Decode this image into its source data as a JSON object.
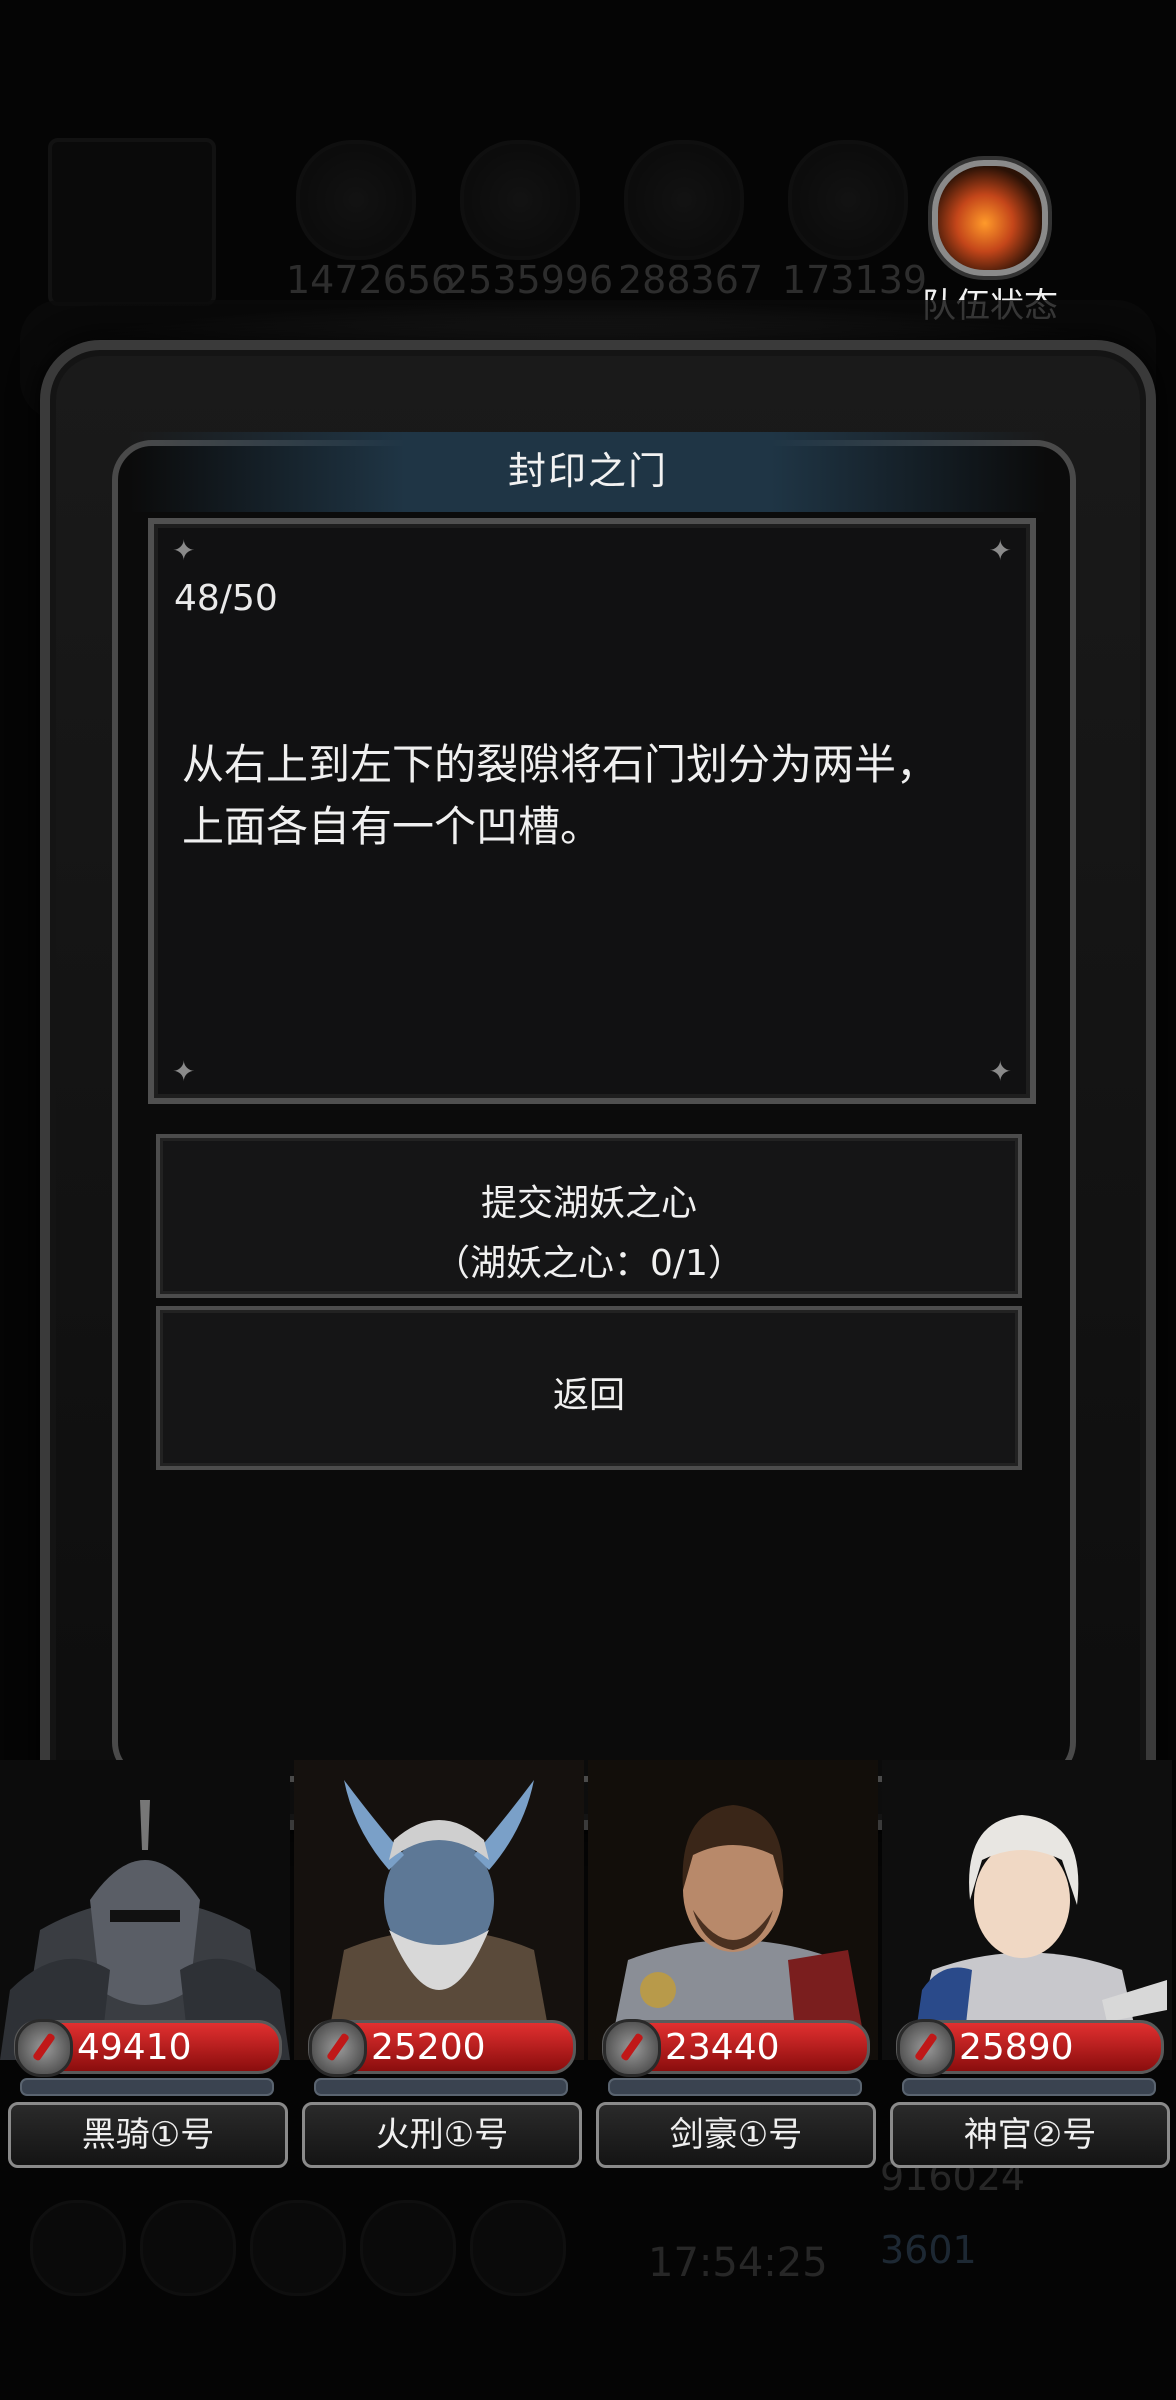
{
  "background_hud": {
    "resources": [
      "1472656",
      "2535996",
      "288367",
      "173139"
    ],
    "clock": "17:54:25",
    "gold": "916024",
    "gems": "3601"
  },
  "team_status": {
    "label": "队伍状态",
    "icon": "fire-emblem-icon"
  },
  "dialog": {
    "title": "封印之门",
    "counter": "48/50",
    "description_line1": "从右上到左下的裂隙将石门划分为两半，",
    "description_line2": "上面各自有一个凹槽。",
    "submit_button": {
      "line1": "提交湖妖之心",
      "line2": "（湖妖之心：0/1）"
    },
    "back_button": "返回"
  },
  "party": [
    {
      "name": "黑骑①号",
      "hp": "49410",
      "portrait": "black-knight"
    },
    {
      "name": "火刑①号",
      "hp": "25200",
      "portrait": "horned-elder"
    },
    {
      "name": "剑豪①号",
      "hp": "23440",
      "portrait": "swordsman"
    },
    {
      "name": "神官②号",
      "hp": "25890",
      "portrait": "priest"
    }
  ],
  "colors": {
    "hp_red": "#c81818",
    "title_bar": "#1f3545",
    "frame": "#4a4a4a"
  }
}
